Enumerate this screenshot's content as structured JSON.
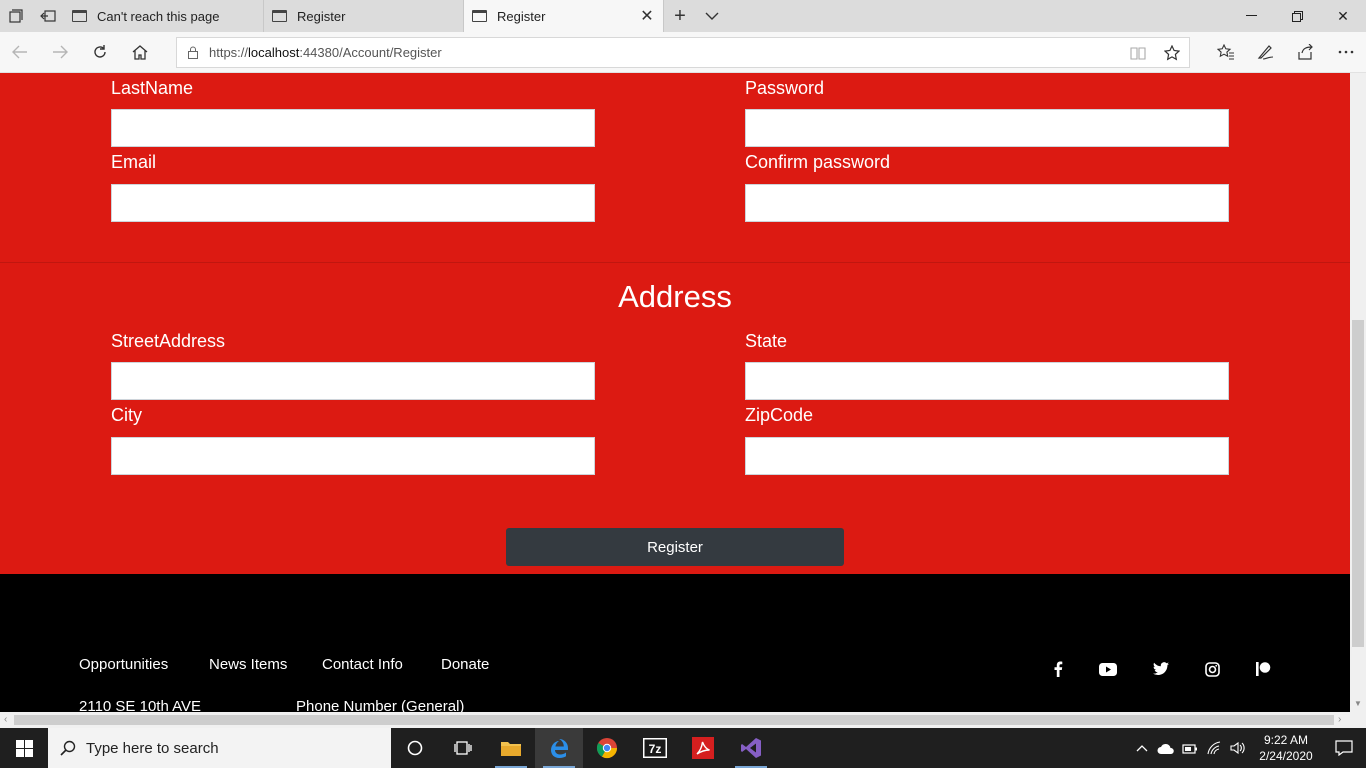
{
  "browser": {
    "tabs": [
      {
        "title": "Can't reach this page",
        "active": false
      },
      {
        "title": "Register",
        "active": false
      },
      {
        "title": "Register",
        "active": true
      }
    ],
    "url": {
      "scheme": "https://",
      "host": "localhost",
      "rest": ":44380/Account/Register"
    }
  },
  "form": {
    "labels": {
      "last_name": "LastName",
      "password": "Password",
      "email": "Email",
      "confirm_password": "Confirm password",
      "street_address": "StreetAddress",
      "state": "State",
      "city": "City",
      "zip_code": "ZipCode"
    },
    "values": {
      "last_name": "",
      "password": "",
      "email": "",
      "confirm_password": "",
      "street_address": "",
      "state": "",
      "city": "",
      "zip_code": ""
    },
    "address_heading": "Address",
    "register_label": "Register"
  },
  "footer": {
    "links": [
      "Opportunities",
      "News Items",
      "Contact Info",
      "Donate"
    ],
    "address": "2110 SE 10th AVE",
    "phone_label": "Phone Number (General)",
    "social_icons": [
      "facebook-icon",
      "youtube-icon",
      "twitter-icon",
      "instagram-icon",
      "patreon-icon"
    ]
  },
  "taskbar": {
    "search_placeholder": "Type here to search",
    "time": "9:22 AM",
    "date": "2/24/2020"
  },
  "colors": {
    "page_background": "#dc1a12",
    "footer_background": "#000000",
    "button_background": "#343a40"
  }
}
